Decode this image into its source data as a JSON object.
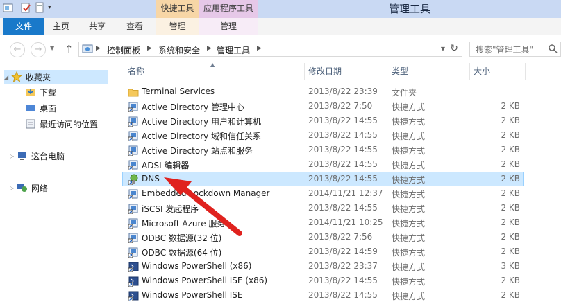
{
  "window": {
    "title": "管理工具"
  },
  "contextual_tabs": {
    "quick_tools": "快捷工具",
    "app_tools": "应用程序工具"
  },
  "ribbon": {
    "tabs": [
      "文件",
      "主页",
      "共享",
      "查看"
    ],
    "quick_tools_manage": "管理",
    "app_tools_manage": "管理"
  },
  "address": {
    "crumbs": [
      "控制面板",
      "系统和安全",
      "管理工具"
    ]
  },
  "search": {
    "placeholder": "搜索\"管理工具\""
  },
  "nav": {
    "favorites": "收藏夹",
    "downloads": "下载",
    "desktop": "桌面",
    "recent": "最近访问的位置",
    "this_pc": "这台电脑",
    "network": "网络"
  },
  "columns": {
    "name": "名称",
    "date": "修改日期",
    "type": "类型",
    "size": "大小"
  },
  "files": [
    {
      "name": "Terminal Services",
      "date": "2013/8/22 23:39",
      "type": "文件夹",
      "size": "",
      "icon": "folder-icon"
    },
    {
      "name": "Active Directory 管理中心",
      "date": "2013/8/22 7:50",
      "type": "快捷方式",
      "size": "2 KB",
      "icon": "shortcut-icon"
    },
    {
      "name": "Active Directory 用户和计算机",
      "date": "2013/8/22 14:55",
      "type": "快捷方式",
      "size": "2 KB",
      "icon": "shortcut-icon"
    },
    {
      "name": "Active Directory 域和信任关系",
      "date": "2013/8/22 14:55",
      "type": "快捷方式",
      "size": "2 KB",
      "icon": "shortcut-icon"
    },
    {
      "name": "Active Directory 站点和服务",
      "date": "2013/8/22 14:55",
      "type": "快捷方式",
      "size": "2 KB",
      "icon": "shortcut-icon"
    },
    {
      "name": "ADSI 编辑器",
      "date": "2013/8/22 14:55",
      "type": "快捷方式",
      "size": "2 KB",
      "icon": "shortcut-icon"
    },
    {
      "name": "DNS",
      "date": "2013/8/22 14:55",
      "type": "快捷方式",
      "size": "2 KB",
      "icon": "dns-shortcut-icon"
    },
    {
      "name": "Embedded Lockdown Manager",
      "date": "2014/11/21 12:37",
      "type": "快捷方式",
      "size": "2 KB",
      "icon": "shortcut-icon"
    },
    {
      "name": "iSCSI 发起程序",
      "date": "2013/8/22 14:55",
      "type": "快捷方式",
      "size": "2 KB",
      "icon": "shortcut-icon"
    },
    {
      "name": "Microsoft Azure 服务",
      "date": "2014/11/21 10:25",
      "type": "快捷方式",
      "size": "2 KB",
      "icon": "shortcut-icon"
    },
    {
      "name": "ODBC 数据源(32 位)",
      "date": "2013/8/22 7:56",
      "type": "快捷方式",
      "size": "2 KB",
      "icon": "shortcut-icon"
    },
    {
      "name": "ODBC 数据源(64 位)",
      "date": "2013/8/22 14:59",
      "type": "快捷方式",
      "size": "2 KB",
      "icon": "shortcut-icon"
    },
    {
      "name": "Windows PowerShell (x86)",
      "date": "2013/8/22 23:37",
      "type": "快捷方式",
      "size": "3 KB",
      "icon": "powershell-icon"
    },
    {
      "name": "Windows PowerShell ISE (x86)",
      "date": "2013/8/22 14:55",
      "type": "快捷方式",
      "size": "2 KB",
      "icon": "powershell-icon"
    },
    {
      "name": "Windows PowerShell ISE",
      "date": "2013/8/22 14:55",
      "type": "快捷方式",
      "size": "2 KB",
      "icon": "powershell-icon"
    }
  ],
  "selected_index": 6,
  "colors": {
    "accent": "#1979ca",
    "selection": "#cce8ff",
    "arrow": "#e0221e"
  }
}
